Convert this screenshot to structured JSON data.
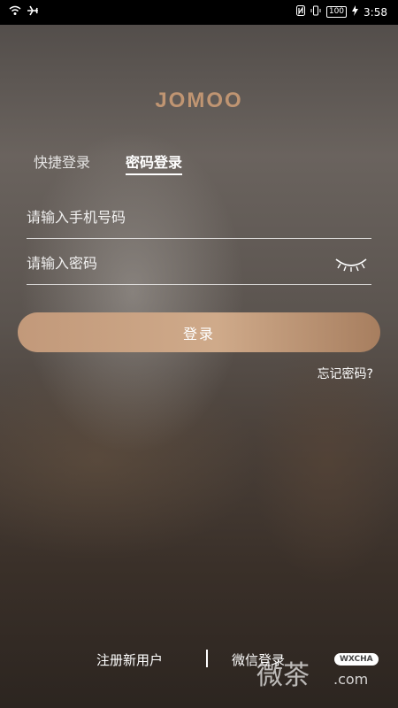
{
  "status_bar": {
    "time": "3:58",
    "battery": "100",
    "left_icons": [
      "wifi-icon",
      "airplane-icon"
    ],
    "right_icons": [
      "nfc-icon",
      "vibrate-icon",
      "battery-icon",
      "charging-icon"
    ]
  },
  "logo": {
    "text": "JOMOO"
  },
  "tabs": [
    {
      "label": "快捷登录",
      "active": false
    },
    {
      "label": "密码登录",
      "active": true
    }
  ],
  "form": {
    "phone_placeholder": "请输入手机号码",
    "password_placeholder": "请输入密码",
    "eye_icon": "eye-closed-icon",
    "login_label": "登录",
    "forgot_label": "忘记密码?"
  },
  "footer": {
    "register_label": "注册新用户",
    "wechat_label": "微信登录"
  },
  "watermark": {
    "main": "微茶",
    "badge": "WXCHA",
    "domain": ".com"
  },
  "colors": {
    "logo": "#c09572",
    "button_gradient_start": "#c2997a",
    "button_gradient_end": "#a77e5f"
  }
}
